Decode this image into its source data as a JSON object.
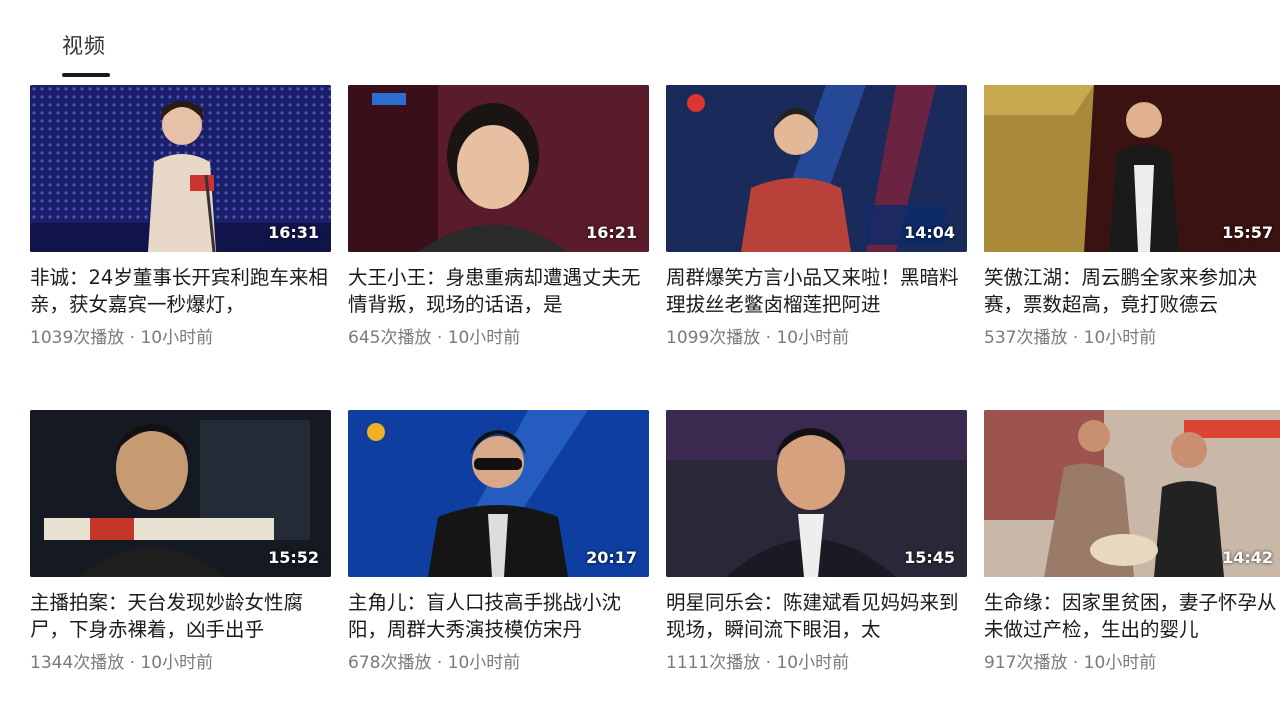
{
  "tabs": [
    {
      "label": "视频",
      "active": true
    }
  ],
  "videos": [
    {
      "title": "非诚：24岁董事长开宾利跑车来相亲，获女嘉宾一秒爆灯，",
      "plays": "1039次播放",
      "time": "10小时前",
      "duration": "16:31"
    },
    {
      "title": "大王小王：身患重病却遭遇丈夫无情背叛，现场的话语，是",
      "plays": "645次播放",
      "time": "10小时前",
      "duration": "16:21"
    },
    {
      "title": "周群爆笑方言小品又来啦！黑暗料理拔丝老鳖卤榴莲把阿进",
      "plays": "1099次播放",
      "time": "10小时前",
      "duration": "14:04"
    },
    {
      "title": "笑傲江湖：周云鹏全家来参加决赛，票数超高，竟打败德云",
      "plays": "537次播放",
      "time": "10小时前",
      "duration": "15:57"
    },
    {
      "title": "主播拍案：天台发现妙龄女性腐尸，下身赤裸着，凶手出乎",
      "plays": "1344次播放",
      "time": "10小时前",
      "duration": "15:52"
    },
    {
      "title": "主角儿：盲人口技高手挑战小沈阳，周群大秀演技模仿宋丹",
      "plays": "678次播放",
      "time": "10小时前",
      "duration": "20:17"
    },
    {
      "title": "明星同乐会：陈建斌看见妈妈来到现场，瞬间流下眼泪，太",
      "plays": "1111次播放",
      "time": "10小时前",
      "duration": "15:45"
    },
    {
      "title": "生命缘：因家里贫困，妻子怀孕从未做过产检，生出的婴儿",
      "plays": "917次播放",
      "time": "10小时前",
      "duration": "14:42"
    }
  ],
  "meta_separator": " · ",
  "colors": {
    "text": "#1b1b1b",
    "meta": "#7a7a7a",
    "tab_underline": "#1a1a1a"
  }
}
